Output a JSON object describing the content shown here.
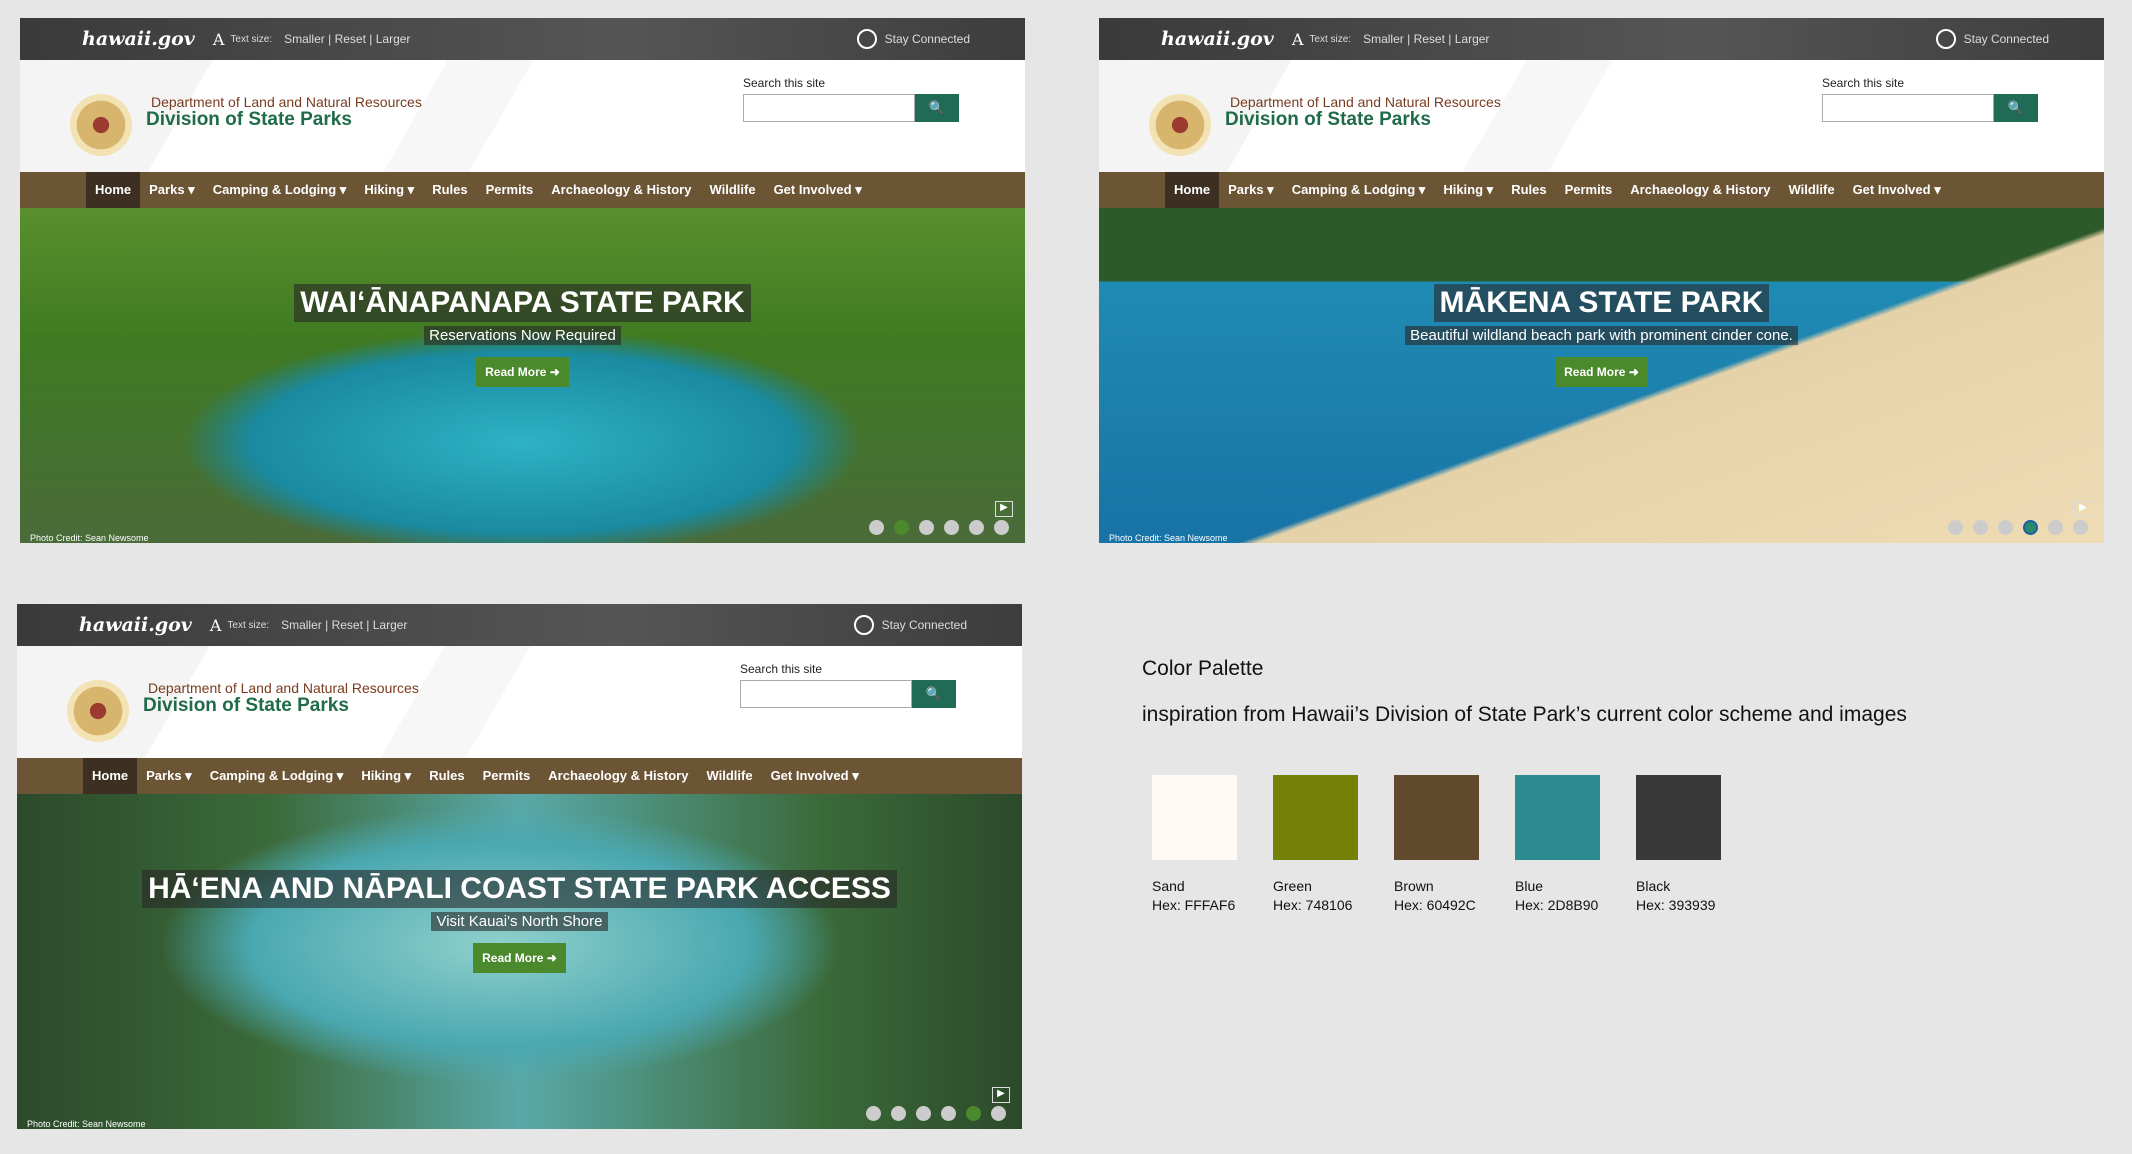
{
  "common": {
    "logo": "hawaii.gov",
    "text_size_label": "Text size:",
    "smaller": "Smaller",
    "reset": "Reset",
    "larger": "Larger",
    "stay_connected": "Stay Connected",
    "dept": "Department of Land and Natural Resources",
    "division": "Division of State Parks",
    "search_label": "Search this site",
    "search_button": "🔍",
    "read_more": "Read More ➜",
    "photo_credit": "Photo Credit: Sean Newsome",
    "nav": [
      "Home",
      "Parks ▾",
      "Camping & Lodging ▾",
      "Hiking ▾",
      "Rules",
      "Permits",
      "Archaeology & History",
      "Wildlife",
      "Get Involved ▾"
    ]
  },
  "panels": [
    {
      "title": "WAIʻĀNAPANAPA STATE PARK",
      "subtitle": "Reservations Now Required",
      "active_slide": 2,
      "slides": 6
    },
    {
      "title": "MĀKENA STATE PARK",
      "subtitle": "Beautiful wildland beach park with prominent cinder cone.",
      "active_slide": 4,
      "slides": 6
    },
    {
      "title": "HĀʻENA AND NĀPALI COAST STATE PARK ACCESS",
      "subtitle": "Visit Kauai's North Shore",
      "active_slide": 5,
      "slides": 6
    }
  ],
  "palette": {
    "title": "Color Palette",
    "subtitle": "inspiration from Hawaii’s Division of State Park’s current color scheme and images",
    "colors": [
      {
        "name": "Sand",
        "hex_label": "Hex: FFFAF6",
        "color": "#FFFAF6"
      },
      {
        "name": "Green",
        "hex_label": "Hex: 748106",
        "color": "#748106"
      },
      {
        "name": "Brown",
        "hex_label": "Hex: 60492C",
        "color": "#60492C"
      },
      {
        "name": "Blue",
        "hex_label": "Hex: 2D8B90",
        "color": "#2D8B90"
      },
      {
        "name": "Black",
        "hex_label": "Hex: 393939",
        "color": "#393939"
      }
    ]
  }
}
